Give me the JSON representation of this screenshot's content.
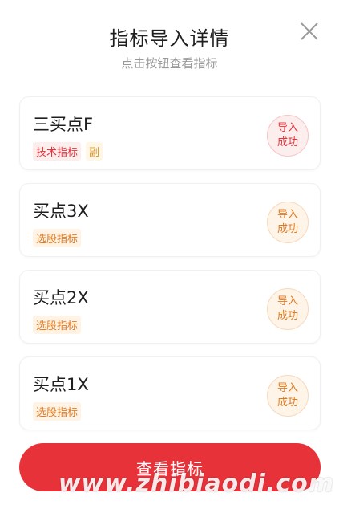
{
  "dialog": {
    "title": "指标导入详情",
    "subtitle": "点击按钮查看指标",
    "close_icon": "close-icon",
    "cta_label": "查看指标"
  },
  "items": [
    {
      "name": "三买点F",
      "tags": [
        {
          "label": "技术指标",
          "color": "#e8323a",
          "bg": "#fdeeee"
        },
        {
          "label": "副",
          "color": "#d99a2b",
          "bg": "#fff6e5"
        }
      ],
      "badge": {
        "line1": "导入",
        "line2": "成功",
        "color": "#e8323a",
        "bg": "#fdeeee",
        "border": "#f6c4c6"
      }
    },
    {
      "name": "买点3X",
      "tags": [
        {
          "label": "选股指标",
          "color": "#e07a1f",
          "bg": "#fff3e6"
        }
      ],
      "badge": {
        "line1": "导入",
        "line2": "成功",
        "color": "#e07a1f",
        "bg": "#fff4e8",
        "border": "#f6d9bd"
      }
    },
    {
      "name": "买点2X",
      "tags": [
        {
          "label": "选股指标",
          "color": "#e07a1f",
          "bg": "#fff3e6"
        }
      ],
      "badge": {
        "line1": "导入",
        "line2": "成功",
        "color": "#e07a1f",
        "bg": "#fff4e8",
        "border": "#f6d9bd"
      }
    },
    {
      "name": "买点1X",
      "tags": [
        {
          "label": "选股指标",
          "color": "#e07a1f",
          "bg": "#fff3e6"
        }
      ],
      "badge": {
        "line1": "导入",
        "line2": "成功",
        "color": "#e07a1f",
        "bg": "#fff4e8",
        "border": "#f6d9bd"
      }
    }
  ],
  "watermark": "www.zhibiaodi.com",
  "colors": {
    "primary": "#e8323a"
  }
}
